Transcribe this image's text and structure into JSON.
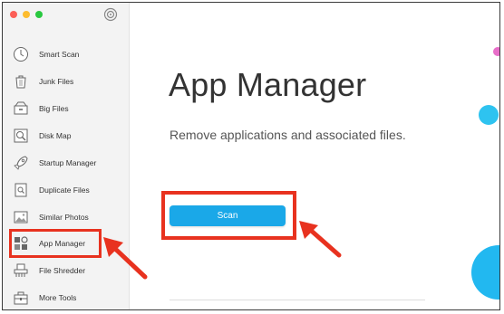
{
  "window": {
    "traffic_lights": [
      "close",
      "minimize",
      "zoom"
    ],
    "colors": {
      "close": "#fc5f57",
      "minimize": "#fdbc2e",
      "zoom": "#29c840"
    }
  },
  "sidebar": {
    "items": [
      {
        "label": "Smart Scan",
        "icon": "clock-icon"
      },
      {
        "label": "Junk Files",
        "icon": "trash-icon"
      },
      {
        "label": "Big Files",
        "icon": "drawer-icon"
      },
      {
        "label": "Disk Map",
        "icon": "magnifier-icon"
      },
      {
        "label": "Startup Manager",
        "icon": "rocket-icon"
      },
      {
        "label": "Duplicate Files",
        "icon": "duplicate-icon"
      },
      {
        "label": "Similar Photos",
        "icon": "photo-icon"
      },
      {
        "label": "App Manager",
        "icon": "app-grid-icon",
        "active": true
      },
      {
        "label": "File Shredder",
        "icon": "shredder-icon"
      },
      {
        "label": "More Tools",
        "icon": "toolbox-icon"
      }
    ]
  },
  "main": {
    "title": "App Manager",
    "subtitle": "Remove applications and associated files.",
    "scan_label": "Scan"
  },
  "colors": {
    "accent": "#1aa8e8",
    "annotation": "#e8321f"
  }
}
